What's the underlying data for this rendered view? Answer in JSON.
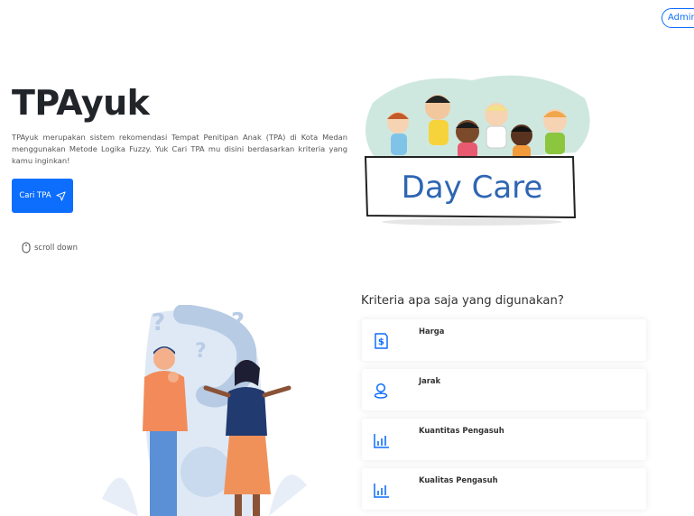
{
  "header": {
    "admin_label": "Admin"
  },
  "hero": {
    "title": "TPAyuk",
    "description": "TPAyuk merupakan sistem rekomendasi Tempat Penitipan Anak (TPA) di Kota Medan menggunakan Metode Logika Fuzzy. Yuk Cari TPA mu disini berdasarkan kriteria yang kamu inginkan!",
    "cta_label": "Cari TPA",
    "scroll_label": "scroll down",
    "sign_text": "Day Care"
  },
  "criteria": {
    "title": "Kriteria apa saja yang digunakan?",
    "items": [
      {
        "label": "Harga",
        "icon": "price-tag-icon"
      },
      {
        "label": "Jarak",
        "icon": "location-pin-icon"
      },
      {
        "label": "Kuantitas Pengasuh",
        "icon": "bar-chart-icon"
      },
      {
        "label": "Kualitas Pengasuh",
        "icon": "bar-chart-icon"
      }
    ]
  },
  "colors": {
    "primary": "#0d6efd",
    "text": "#212529",
    "muted": "#555555"
  }
}
